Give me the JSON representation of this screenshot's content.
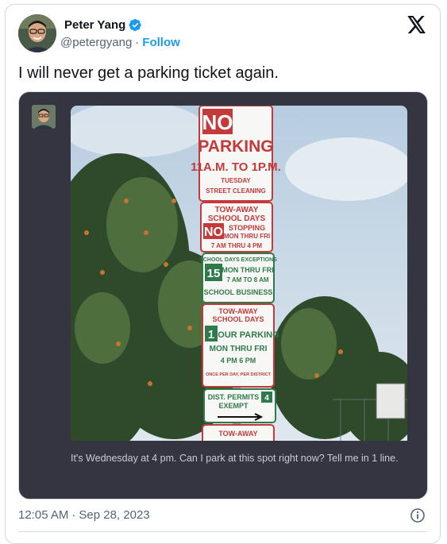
{
  "author": {
    "name": "Peter Yang",
    "handle": "@petergyang",
    "separator": "·",
    "follow_label": "Follow",
    "verified_color": "#1d9bf0"
  },
  "tweet": {
    "text": "I will never get a parking ticket again."
  },
  "media": {
    "prompt": "It's Wednesday at 4 pm. Can I park at this spot right now? Tell me in 1 line.",
    "background": "#343541",
    "signs": {
      "s1": {
        "l1": "NO",
        "l2": "PARKING",
        "l3": "11A.M. TO 1P.M.",
        "l4": "TUESDAY",
        "l5": "STREET CLEANING"
      },
      "s2": {
        "l1": "TOW-AWAY",
        "l2": "SCHOOL DAYS",
        "l3": "NO",
        "l4": "STOPPING",
        "l5": "MON THRU FRI",
        "l6": "7 AM THRU 4 PM"
      },
      "s3": {
        "l1": "SCHOOL DAYS EXCEPTIONS",
        "l2": "15",
        "l3": "MON THRU FRI",
        "l4": "7 AM TO 8 AM",
        "l5": "SCHOOL BUSINESS"
      },
      "s4": {
        "l1": "TOW-AWAY",
        "l2": "SCHOOL DAYS",
        "l3": "1",
        "l4": "HOUR PARKING",
        "l5": "MON THRU FRI",
        "l6": "4 PM  6 PM",
        "l7": "ONCE PER DAY, PER DISTRICT"
      },
      "s5": {
        "l1": "DIST. PERMITS",
        "l2": "4",
        "l3": "EXEMPT"
      },
      "s6": {
        "l1": "TOW-AWAY"
      }
    }
  },
  "footer": {
    "time": "12:05 AM",
    "separator": "·",
    "date": "Sep 28, 2023"
  }
}
